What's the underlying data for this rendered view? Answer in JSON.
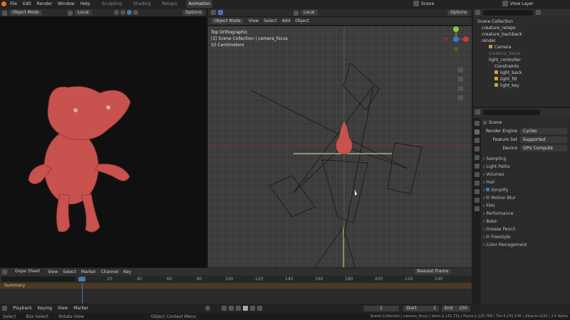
{
  "topbar": {
    "menus": [
      "File",
      "Edit",
      "Render",
      "Window",
      "Help"
    ],
    "workspaces": [
      "Sculpting",
      "Shading",
      "Retopo",
      "Animation"
    ],
    "active_workspace": "Animation",
    "scene": "Scene",
    "view_layer": "View Layer"
  },
  "left_header": {
    "orientation": "Local",
    "options": "Options",
    "mode": "Object Mode"
  },
  "main_header": {
    "orientation": "Local",
    "options": "Options",
    "mode": "Object Mode",
    "menus": [
      "View",
      "Select",
      "Add",
      "Object"
    ]
  },
  "viewport_info": {
    "line1": "Top Orthographic",
    "line2": "(1) Scene Collection | camera_focus",
    "line3": "10 Centimeters"
  },
  "outliner": {
    "items": [
      {
        "label": "Scene Collection",
        "indent": 0
      },
      {
        "label": "creature_retopo",
        "indent": 1
      },
      {
        "label": "creature_backback",
        "indent": 1
      },
      {
        "label": "render",
        "indent": 1
      },
      {
        "label": "Camera",
        "indent": 2
      },
      {
        "label": "creature_focus",
        "indent": 2
      },
      {
        "label": "light_controller",
        "indent": 2
      },
      {
        "label": "Constraints",
        "indent": 3
      },
      {
        "label": "light_back",
        "indent": 3
      },
      {
        "label": "light_fill",
        "indent": 3
      },
      {
        "label": "light_key",
        "indent": 3
      }
    ]
  },
  "properties": {
    "scene_label": "Scene",
    "render_engine_label": "Render Engine",
    "render_engine_value": "Cycles",
    "feature_set_label": "Feature Set",
    "feature_set_value": "Supported",
    "device_label": "Device",
    "device_value": "GPU Compute",
    "sections": [
      "Sampling",
      "Light Paths",
      "Volumes",
      "Hair",
      "Simplify",
      "Motion Blur",
      "Film",
      "Performance",
      "Bake",
      "Grease Pencil",
      "Freestyle",
      "Color Management"
    ]
  },
  "dopesheet": {
    "editor": "Dope Sheet",
    "menus": [
      "View",
      "Select",
      "Marker",
      "Channel",
      "Key"
    ],
    "snap": "Nearest Frame",
    "summary": "Summary",
    "current_frame_marker": "1",
    "ticks": [
      "20",
      "40",
      "60",
      "80",
      "100",
      "120",
      "140",
      "160",
      "180",
      "200",
      "220",
      "240"
    ]
  },
  "timeline": {
    "menus": [
      "Playback",
      "Keying",
      "View",
      "Marker"
    ],
    "current_frame": "1",
    "start_label": "Start",
    "start": "1",
    "end_label": "End",
    "end": "250"
  },
  "status": {
    "select": "Select",
    "box_select": "Box Select",
    "rotate": "Rotate View",
    "context": "Object Context Menu",
    "stats": "Scene Collection | camera_focus | Verts:2,121,731 | Faces:2,120,768 | Tris:4,241,536 | Objects:0/20 | 3.0 Alpha"
  },
  "colors": {
    "accent": "#4772b3",
    "creature": "#c8524e",
    "axis_x": "#c83c3c",
    "axis_y": "#8cc83c",
    "axis_z": "#3c78c8"
  }
}
